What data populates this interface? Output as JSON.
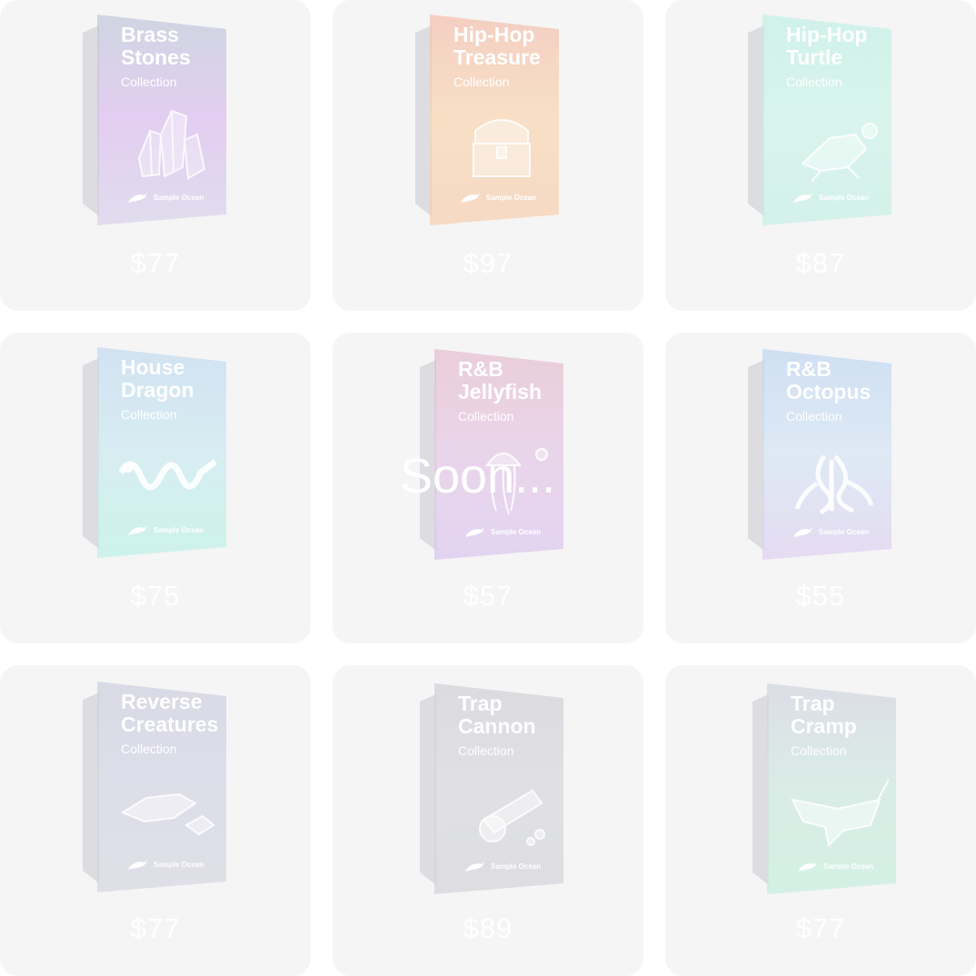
{
  "overlay_text": "Soon...",
  "collection_label": "Collection",
  "brand_label": "Sample Ocean",
  "products": [
    {
      "name": "Brass\nStones",
      "price": "$77",
      "art_icon": "crystal-rocks-icon",
      "gradient": [
        "#b8c2d6",
        "#d8b5ee",
        "#d4cee8"
      ]
    },
    {
      "name": "Hip-Hop\nTreasure",
      "price": "$97",
      "art_icon": "treasure-chest-icon",
      "gradient": [
        "#f3b7a3",
        "#f9d2a8",
        "#f6c8a6"
      ]
    },
    {
      "name": "Hip-Hop\nTurtle",
      "price": "$87",
      "art_icon": "turtle-icon",
      "gradient": [
        "#b8f0e2",
        "#c7f3e7",
        "#bfeee3"
      ]
    },
    {
      "name": "House\nDragon",
      "price": "$75",
      "art_icon": "dragon-icon",
      "gradient": [
        "#bcd6f0",
        "#c6e8f0",
        "#b4f1e4"
      ]
    },
    {
      "name": "R&B\nJellyfish",
      "price": "$57",
      "art_icon": "jellyfish-icon",
      "gradient": [
        "#e3b5c8",
        "#e2c2e4",
        "#d6c0ee"
      ]
    },
    {
      "name": "R&B\nOctopus",
      "price": "$55",
      "art_icon": "octopus-icon",
      "gradient": [
        "#b8d2f2",
        "#cfe2f4",
        "#dccbf0"
      ]
    },
    {
      "name": "Reverse\nCreatures",
      "price": "$77",
      "art_icon": "sea-creatures-icon",
      "gradient": [
        "#c7c9dc",
        "#cfd0e2",
        "#d2d2e0"
      ]
    },
    {
      "name": "Trap\nCannon",
      "price": "$89",
      "art_icon": "cannon-icon",
      "gradient": [
        "#cbcbd3",
        "#d2d2da",
        "#cfd0d6"
      ]
    },
    {
      "name": "Trap\nCramp",
      "price": "$77",
      "art_icon": "manta-ray-icon",
      "gradient": [
        "#cdd0dc",
        "#c9e6dc",
        "#bfeedb"
      ]
    }
  ]
}
